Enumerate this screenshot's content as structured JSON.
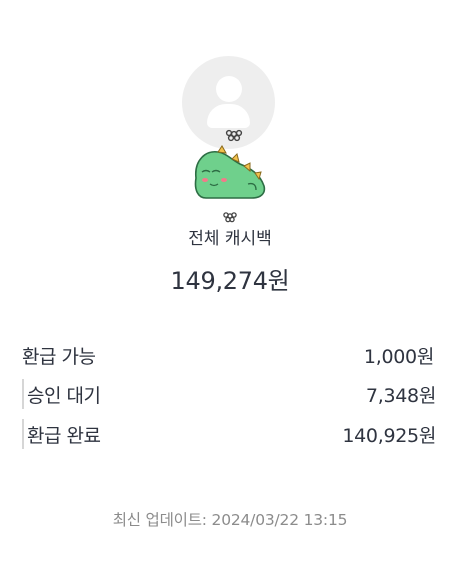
{
  "summary": {
    "title": "전체 캐시백",
    "total": "149,274원"
  },
  "breakdown": [
    {
      "label": "환급 가능",
      "value": "1,000원"
    },
    {
      "label": "승인 대기",
      "value": "7,348원"
    },
    {
      "label": "환급 완료",
      "value": "140,925원"
    }
  ],
  "footer": {
    "updated": "최신 업데이트: 2024/03/22 13:15"
  },
  "colors": {
    "text": "#2f3440",
    "muted": "#8c8c8c",
    "avatar_bg": "#eeeeee",
    "mascot_green": "#6fd08c"
  },
  "icons": {
    "avatar": "default-user-avatar-icon",
    "mascot": "green-dinosaur-mascot-icon"
  }
}
